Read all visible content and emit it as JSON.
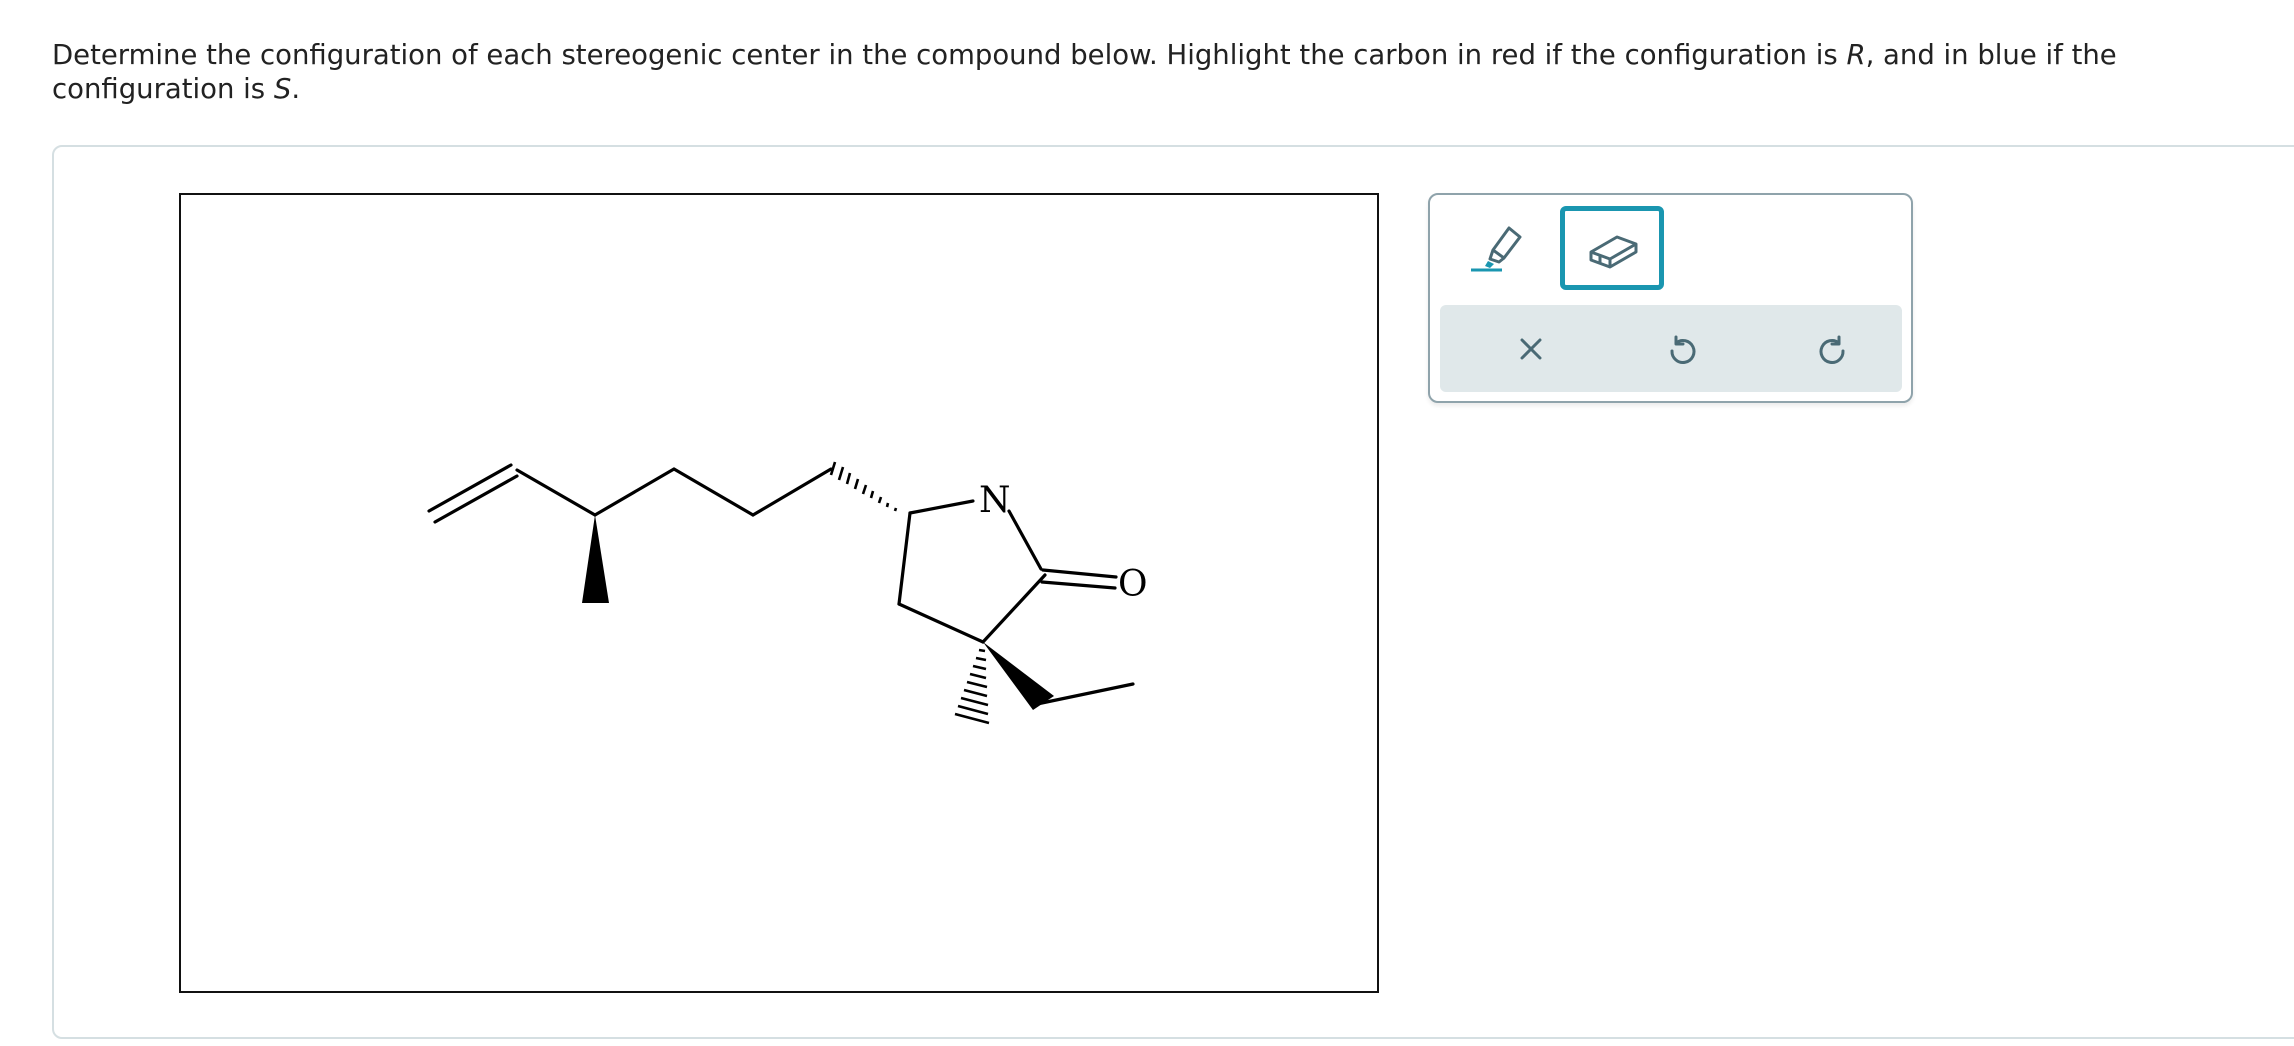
{
  "prompt": {
    "part1": "Determine the configuration of each stereogenic center in the compound below. Highlight the carbon in red if the configuration is ",
    "r_label": "R",
    "part2": ", and in blue if the configuration is ",
    "s_label": "S",
    "part3": "."
  },
  "molecule": {
    "atoms": {
      "nitrogen": "N",
      "oxygen": "O"
    }
  },
  "toolbar": {
    "tools": [
      {
        "name": "highlighter",
        "icon": "highlighter-icon",
        "selected": false
      },
      {
        "name": "eraser",
        "icon": "eraser-icon",
        "selected": true
      }
    ],
    "actions": [
      {
        "name": "clear",
        "icon": "close-icon"
      },
      {
        "name": "undo",
        "icon": "undo-icon"
      },
      {
        "name": "redo",
        "icon": "redo-icon"
      }
    ]
  },
  "colors": {
    "accent": "#1a96b0",
    "icon": "#4a6a75",
    "action_bar_bg": "#e0e8ea",
    "panel_border": "#d5dfe2"
  }
}
